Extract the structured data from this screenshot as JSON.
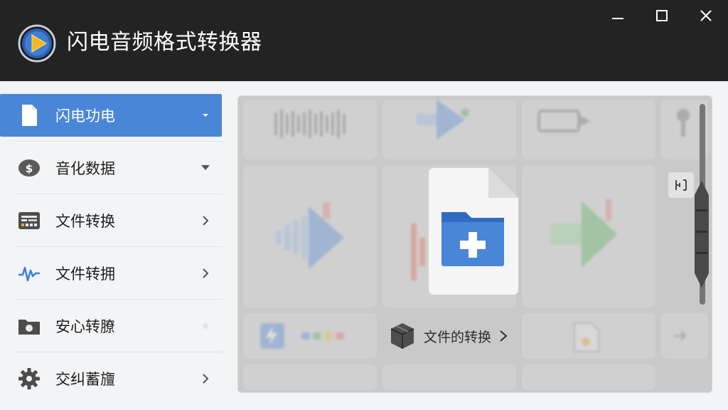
{
  "window": {
    "title": "闪电音频格式转换器",
    "accent": "#4a86d8",
    "titlebar_bg": "#232323"
  },
  "window_controls": {
    "minimize_icon": "minimize-icon",
    "maximize_icon": "maximize-icon",
    "close_icon": "close-icon"
  },
  "sidebar": {
    "items": [
      {
        "label": "闪电功电",
        "icon": "document-icon",
        "chevron": "caret-down-icon",
        "active": true
      },
      {
        "label": "音化数据",
        "icon": "dollar-coin-icon",
        "chevron": "caret-down-icon",
        "active": false
      },
      {
        "label": "文件转换",
        "icon": "equalizer-panel-icon",
        "chevron": "chevron-right-icon",
        "active": false
      },
      {
        "label": "文件转拥",
        "icon": "waveform-icon",
        "chevron": "chevron-right-icon",
        "active": false
      },
      {
        "label": "安心转膫",
        "icon": "camera-folder-icon",
        "chevron": "diamond-icon",
        "active": false
      },
      {
        "label": "交纠蓄旜",
        "icon": "gear-icon",
        "chevron": "chevron-right-icon",
        "active": false
      }
    ]
  },
  "main": {
    "center_file_icon": "add-file-folder-icon",
    "caption_label": "文件的转换",
    "caption_icon": "box-icon",
    "side_tool_icon": "fit-bracket-icon"
  }
}
